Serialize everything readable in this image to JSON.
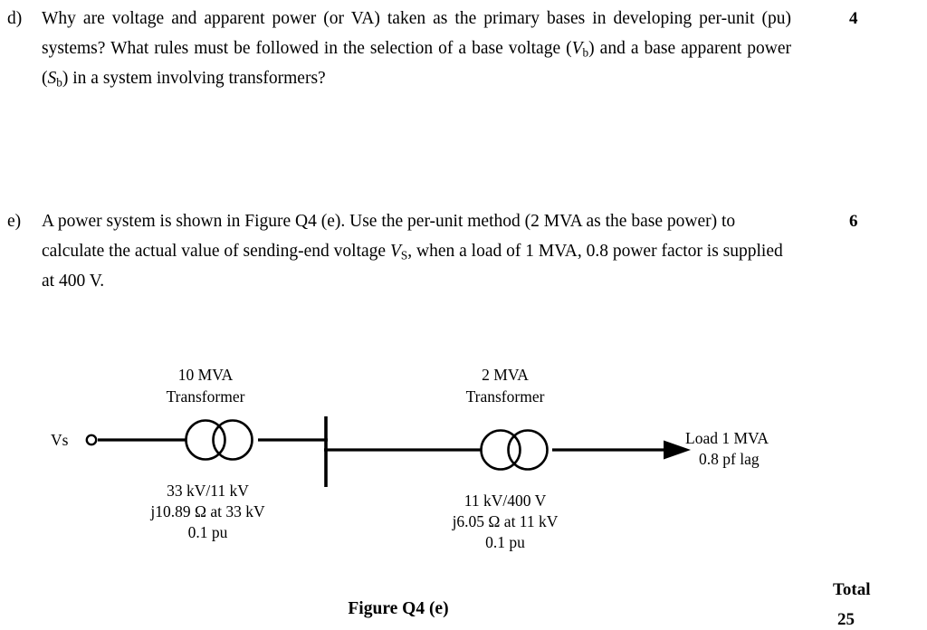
{
  "document": {
    "type": "exam-question-page",
    "figure_caption": "Figure Q4 (e)",
    "total_label": "Total",
    "total_value": "25"
  },
  "questions": [
    {
      "label": "d)",
      "marks": "4",
      "lines": [
        "Why are voltage and apparent power (or VA) taken as the primary bases in",
        "developing per-unit (pu) systems? What rules must be followed in the",
        "selection of a base voltage (Vb) and a base apparent power (Sb) in a system",
        "involving transformers?"
      ],
      "text_part_1": "Why are voltage and apparent power (or VA) taken as the primary bases in developing per-unit (pu) systems? What rules must be followed in the selection of a base voltage (",
      "sym_1": "V",
      "sub_1": "b",
      "text_part_2": ") and a base apparent power (",
      "sym_2": "S",
      "sub_2": "b",
      "text_part_3": ") in a system involving transformers?"
    },
    {
      "label": "e)",
      "marks": "6",
      "text_part_1": "A power system is shown in Figure Q4 (e). Use the per-unit method (2 MVA as the base power) to calculate the actual value of sending-end voltage ",
      "sym_1": "V",
      "sub_1": "S",
      "text_part_2": ", when a load of 1 MVA, 0.8 power factor is supplied at 400 V."
    }
  ],
  "figure": {
    "source_label": "Vs",
    "transformer_1": {
      "rating": "10 MVA",
      "type": "Transformer",
      "ratio": "33 kV/11 kV",
      "impedance": "j10.89 Ω at 33 kV",
      "pu": "0.1 pu"
    },
    "transformer_2": {
      "rating": "2 MVA",
      "type": "Transformer",
      "ratio": "11 kV/400 V",
      "impedance": "j6.05 Ω at 11 kV",
      "pu": "0.1 pu"
    },
    "load": {
      "line1": "Load 1 MVA",
      "line2": "0.8 pf lag"
    }
  },
  "colors": {
    "ink": "#000000",
    "paper": "#ffffff"
  }
}
